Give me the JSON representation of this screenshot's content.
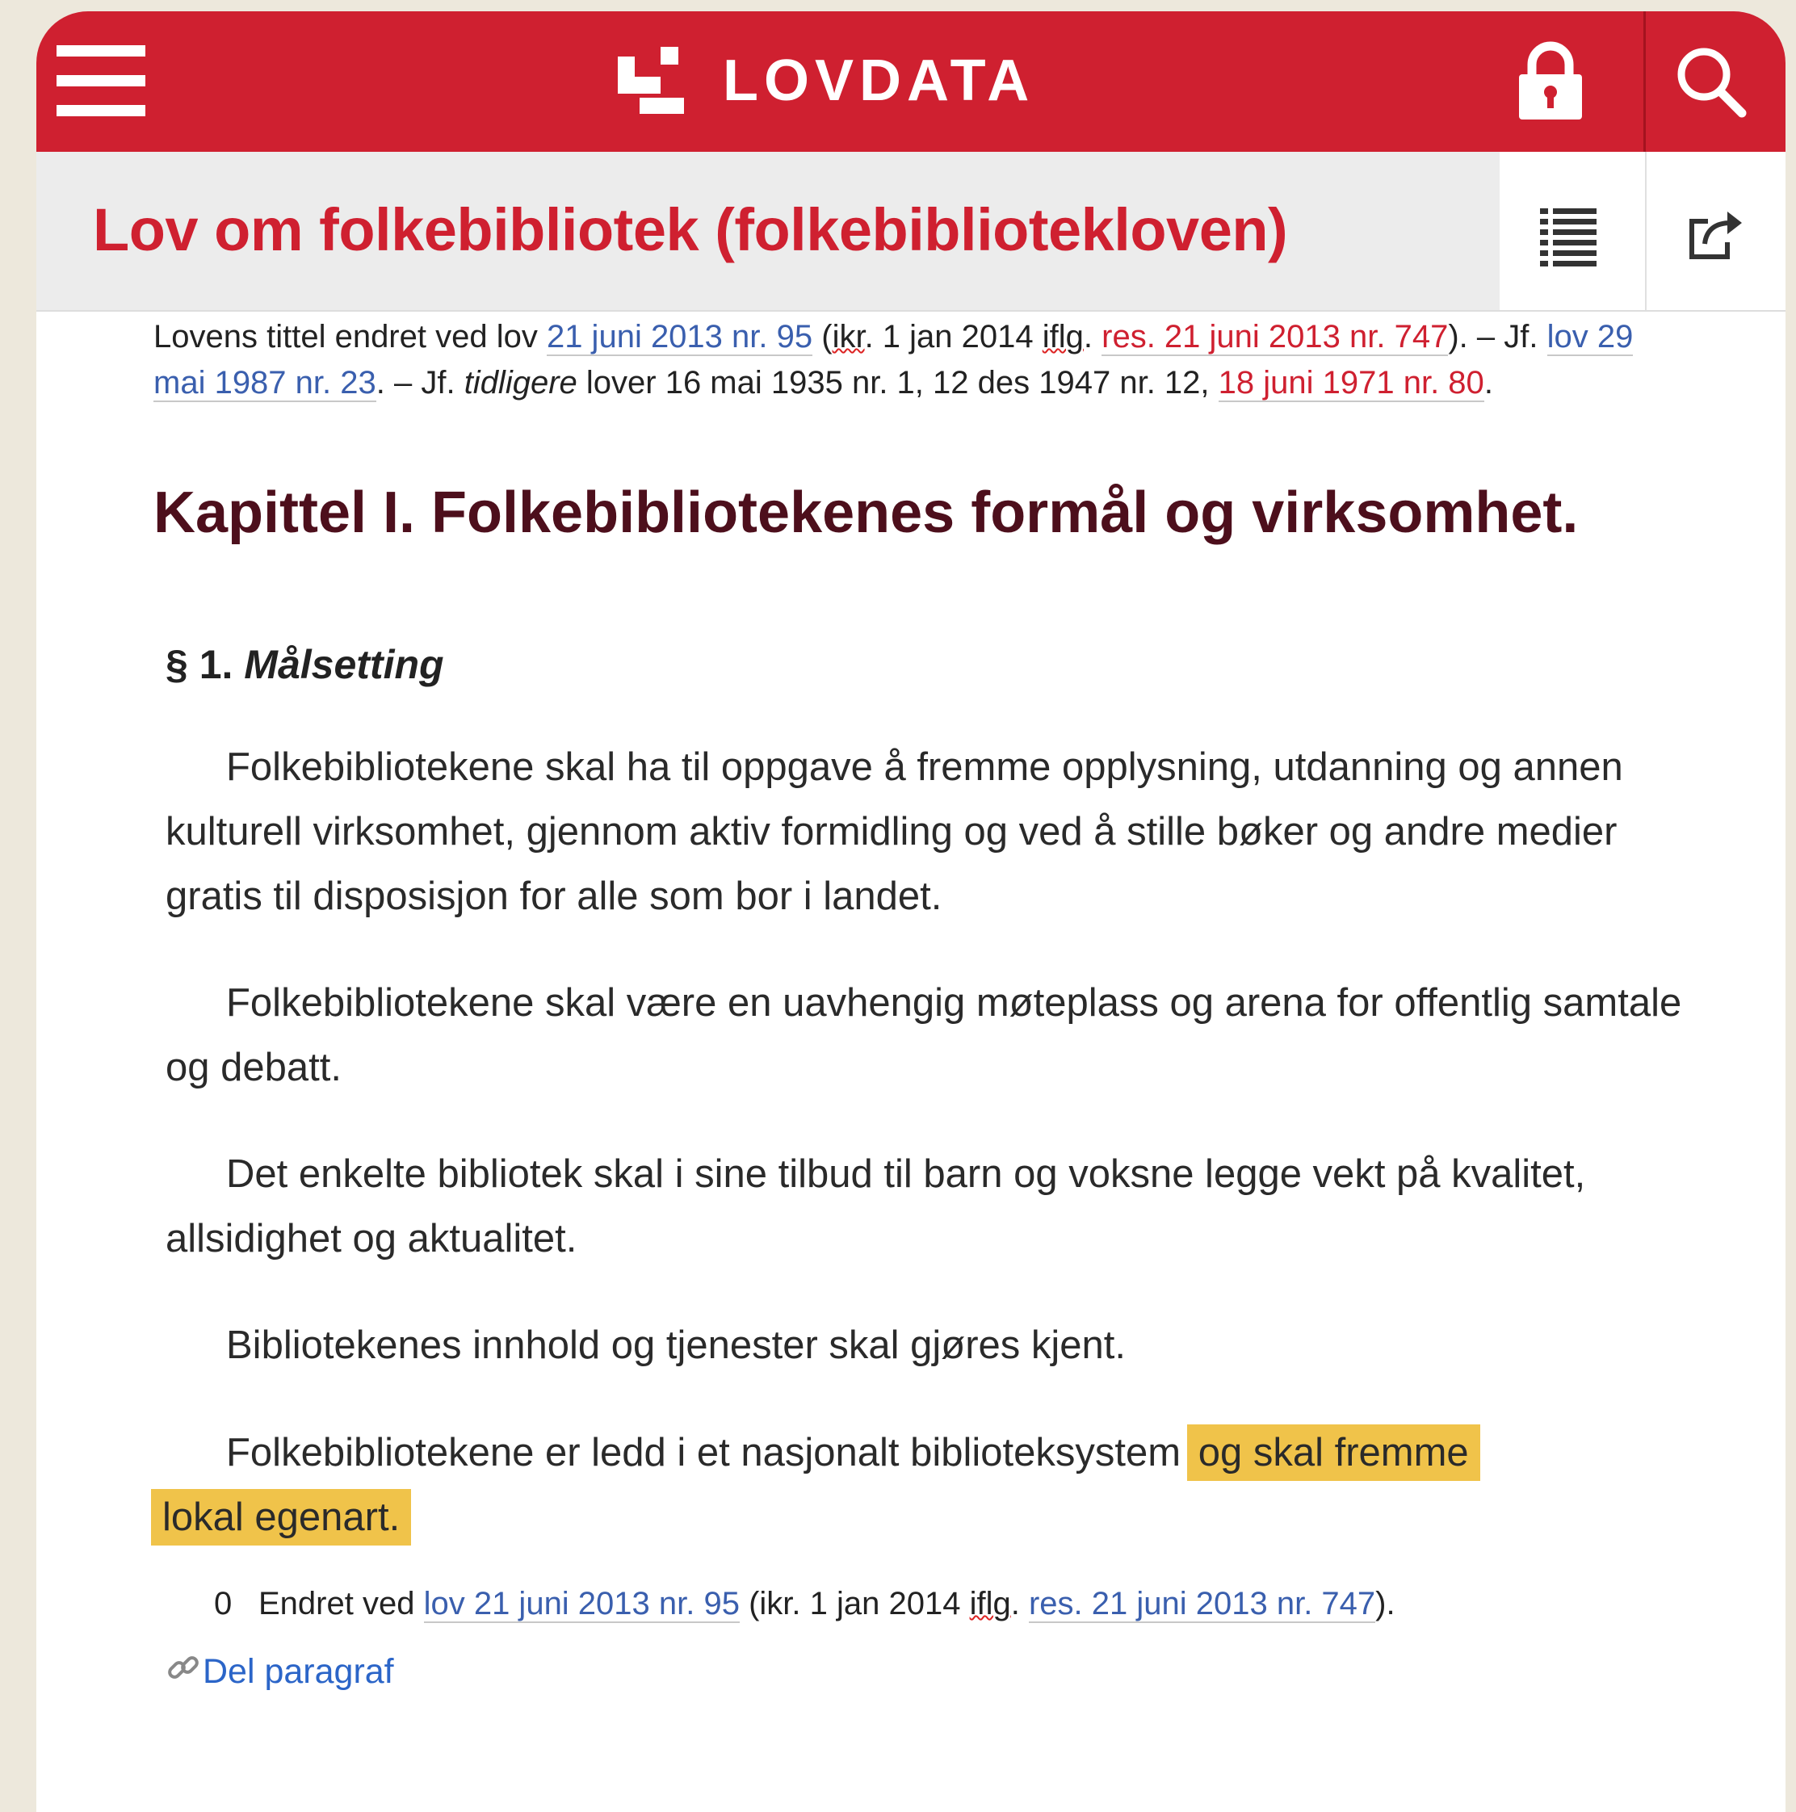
{
  "app": {
    "logo_text": "LOVDATA",
    "brand_color": "#cf2030"
  },
  "header": {
    "menu_icon": "hamburger-menu-icon",
    "lock_icon": "lock-icon",
    "search_icon": "search-icon"
  },
  "page": {
    "title": "Lov om folkebibliotek (folkebibliotekloven)",
    "toc_icon": "list-icon",
    "share_icon": "share-icon"
  },
  "meta": {
    "t1": "Lovens tittel endret ved lov ",
    "l1": "21 juni 2013 nr. 95",
    "t2": " (",
    "ikr": "ikr",
    "t3": ". 1 jan 2014 ",
    "iflg": "iflg",
    "t4": ". ",
    "l2": "res. 21 juni 2013 nr. 747",
    "t5": "). – Jf. ",
    "l3": "lov 29 mai 1987 nr. 23",
    "t6": ". – Jf. ",
    "tidligere": "tidligere",
    "t7": " lover 16 mai 1935 nr. 1, 12 des 1947 nr. 12, ",
    "l4": "18 juni 1971 nr. 80",
    "t8": "."
  },
  "chapter": {
    "title": "Kapittel I. Folkebibliotekenes formål og virksomhet."
  },
  "section": {
    "number": "§ 1. ",
    "title": "Målsetting",
    "p1": "Folkebibliotekene skal ha til oppgave å fremme opplysning, utdanning og annen kulturell virksomhet, gjennom aktiv formidling og ved å stille bøker og andre medier gratis til disposisjon for alle som bor i landet.",
    "p2": "Folkebibliotekene skal være en uavhengig møteplass og arena for offentlig samtale og debatt.",
    "p3": "Det enkelte bibliotek skal i sine tilbud til barn og voksne legge vekt på kvalitet, allsidighet og aktualitet.",
    "p4": "Bibliotekenes innhold og tjenester skal gjøres kjent.",
    "p5_start": "Folkebibliotekene er ledd i et nasjonalt biblioteksystem ",
    "p5_hl1": "og skal fremme",
    "p5_hl2": "lokal egenart.",
    "highlight_color": "#f0c34a"
  },
  "amendment": {
    "number": "0",
    "t1": "Endret ved ",
    "l1": "lov 21 juni 2013 nr. 95",
    "t2": " (ikr. 1 jan 2014 ",
    "iflg": "iflg",
    "t3": ". ",
    "l2": "res. 21 juni 2013 nr. 747",
    "t4": ")."
  },
  "share_paragraph": {
    "icon": "link-icon",
    "label": "Del paragraf"
  }
}
